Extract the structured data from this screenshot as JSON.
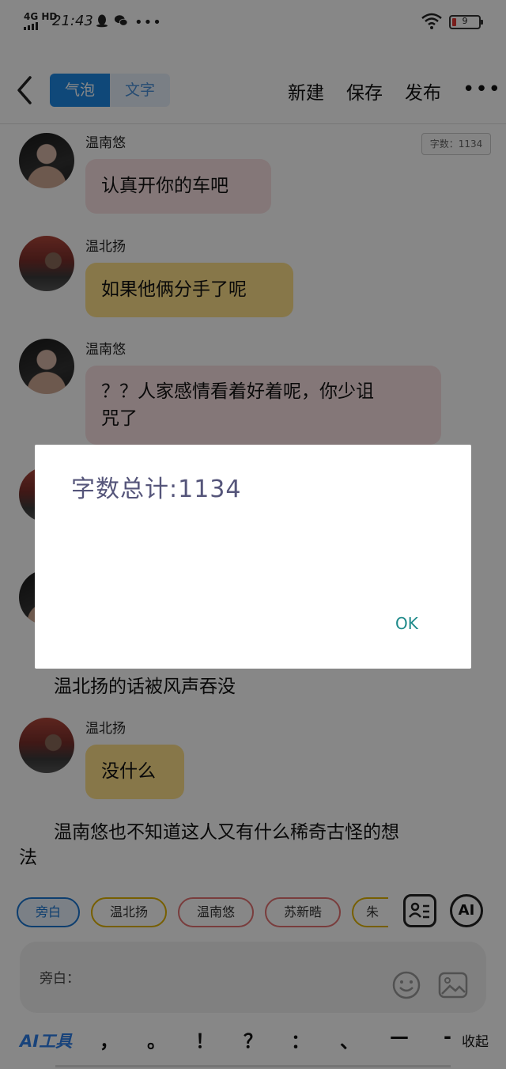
{
  "status_bar": {
    "network": "4G HD",
    "time": "21:43",
    "battery_level": "9"
  },
  "header": {
    "mode_tabs": [
      "气泡",
      "文字"
    ],
    "active_tab": "气泡",
    "actions": [
      "新建",
      "保存",
      "发布"
    ],
    "more_label": "•••"
  },
  "word_count_badge": "字数：1134",
  "messages": [
    {
      "speaker": "温南悠",
      "text": "认真开你的车吧"
    },
    {
      "speaker": "温北扬",
      "text": "如果他俩分手了呢"
    },
    {
      "speaker": "温南悠",
      "text_line1": "？？人家感情看着好着呢，你少诅",
      "text_line2": "咒了"
    },
    {
      "narration": "温北扬的话被风声吞没"
    },
    {
      "speaker": "温北扬",
      "text": "没什么"
    },
    {
      "narration_line1": "温南悠也不知道这人又有什么稀奇古怪的想",
      "narration_line2": "法"
    }
  ],
  "role_chips": [
    "旁白",
    "温北扬",
    "温南悠",
    "苏新晧",
    "朱"
  ],
  "input": {
    "label": "旁白："
  },
  "ai_tool_label": "AI工具",
  "punctuation": [
    "，",
    "。",
    "！",
    "？",
    "：",
    "、",
    "—",
    "-"
  ],
  "collapse_label": "收起",
  "ai_button_label": "AI",
  "dialog": {
    "message": "字数总计:1134",
    "ok_label": "OK"
  },
  "colors": {
    "accent_blue": "#1e88e5",
    "bubble_pink": "#fae1e3",
    "bubble_yellow": "#ffe08a",
    "ok_teal": "#1e8a8a"
  }
}
